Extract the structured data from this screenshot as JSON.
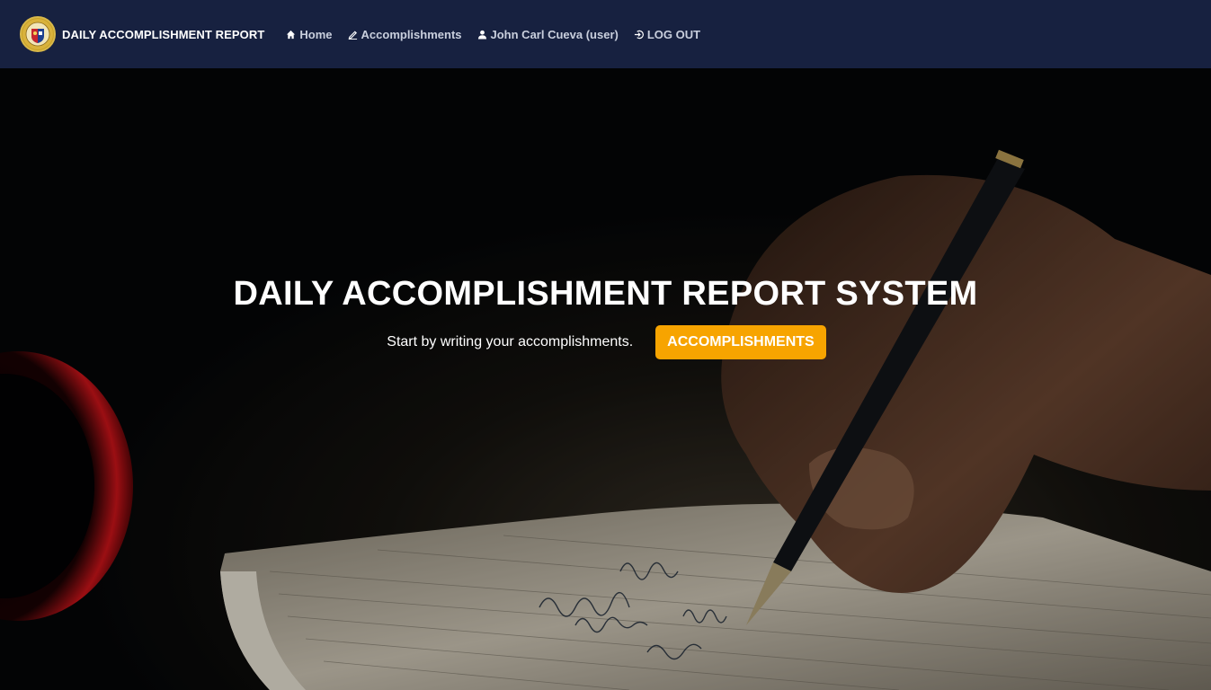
{
  "navbar": {
    "brand": "DAILY ACCOMPLISHMENT REPORT",
    "links": [
      {
        "label": "Home",
        "icon": "home-icon"
      },
      {
        "label": "Accomplishments",
        "icon": "pencil-icon"
      },
      {
        "label": "John Carl Cueva (user)",
        "icon": "user-icon"
      },
      {
        "label": "LOG OUT",
        "icon": "logout-icon"
      }
    ],
    "background": "#172140"
  },
  "hero": {
    "title": "DAILY ACCOMPLISHMENT REPORT SYSTEM",
    "subtitle": "Start by writing your accomplishments.",
    "cta_label": "ACCOMPLISHMENTS",
    "cta_color": "#f7a400"
  }
}
